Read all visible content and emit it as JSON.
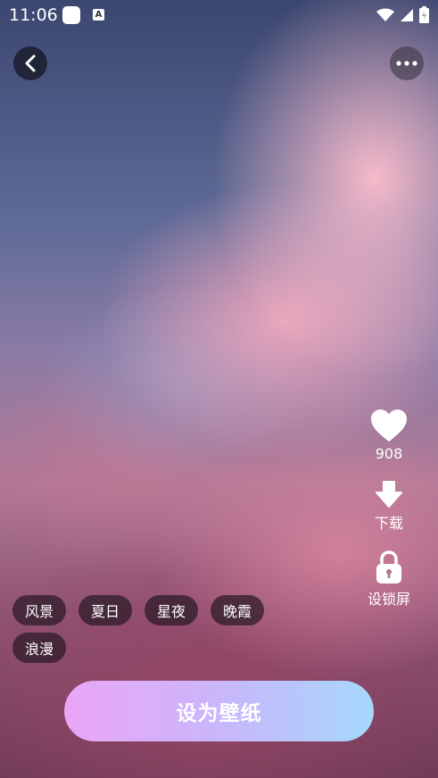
{
  "status_bar": {
    "time": "11:06",
    "notification_b": "A"
  },
  "tags": [
    "风景",
    "夏日",
    "星夜",
    "晚霞",
    "浪漫"
  ],
  "actions": {
    "like_count": "908",
    "download_label": "下载",
    "lockscreen_label": "设锁屏"
  },
  "set_wallpaper_label": "设为壁纸",
  "colors": {
    "button_gradient_start": "#eaa6f5",
    "button_gradient_end": "#a6d8fb",
    "tag_bg": "#281926"
  }
}
